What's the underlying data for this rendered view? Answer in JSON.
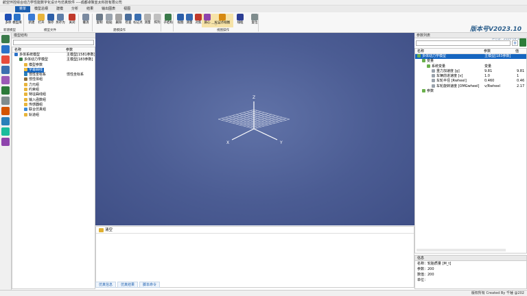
{
  "window_title": "航空环控综合动力学性能数字化设计与仿真软件 ----成都卓致亚太科技有限公司",
  "menu": [
    "菜单",
    "模型总纲",
    "建模",
    "分析",
    "结果",
    "输出图表",
    "视图"
  ],
  "ribbon": {
    "buttons": [
      {
        "label": "多体",
        "color": "#1f4fb5"
      },
      {
        "label": "模型库",
        "color": "#2a72c9"
      },
      {
        "label": "新建",
        "color": "#3a7bd5"
      },
      {
        "label": "打开",
        "color": "#e8b43a"
      },
      {
        "label": "保存",
        "color": "#2d5fa8"
      },
      {
        "label": "另存为",
        "color": "#5f7ea8"
      },
      {
        "label": "关闭",
        "color": "#c0392b"
      },
      {
        "label": "撤消",
        "color": "#7a8aa0"
      },
      {
        "label": "复制",
        "color": "#6c7a89"
      },
      {
        "label": "粘贴",
        "color": "#9aa3ad"
      },
      {
        "label": "删除",
        "color": "#a3a3a3"
      },
      {
        "label": "检查",
        "color": "#4a6d9a"
      },
      {
        "label": "标记点",
        "color": "#3b6fb0"
      },
      {
        "label": "测量",
        "color": "#b0b0b0"
      },
      {
        "label": "阵列",
        "color": "#c0c0c0"
      },
      {
        "label": "子结构",
        "color": "#3a7a4a"
      },
      {
        "label": "视图",
        "color": "#2b5ea8"
      },
      {
        "label": "测量",
        "color": "#3469b0"
      },
      {
        "label": "对焦",
        "color": "#c0392b"
      },
      {
        "label": "质心",
        "color": "#8e44ad"
      },
      {
        "label": "标记点视图",
        "color": "#d68910"
      },
      {
        "label": "线框",
        "color": "#2c3e94"
      },
      {
        "label": "复位",
        "color": "#7f8c8d"
      }
    ],
    "groups": [
      "新建模型",
      "模型文件",
      "建模操作",
      "视图操作"
    ],
    "view_slider": "一○—"
  },
  "version": {
    "title": "版本号V2023.10",
    "license": "使用期：2.11.19",
    "date": "许可证：2024-08-21"
  },
  "left_panel": {
    "title": "模型结构",
    "col_name": "名称",
    "col_param": "参数",
    "rows": [
      {
        "name": "多体系统模型",
        "param": "主模型[1581参数]",
        "indent": 0
      },
      {
        "name": "多体动力学模型",
        "param": "主模型[183参数]",
        "indent": 1
      },
      {
        "name": "模型参数",
        "param": "",
        "indent": 2
      },
      {
        "name": "字幕曲线",
        "param": "",
        "indent": 2,
        "selected": true
      },
      {
        "name": "惯性坐标系",
        "param": "惯性坐标系",
        "indent": 2
      },
      {
        "name": "惯性体组",
        "param": "",
        "indent": 2
      },
      {
        "name": "力元组",
        "param": "",
        "indent": 2
      },
      {
        "name": "约束组",
        "param": "",
        "indent": 2
      },
      {
        "name": "特征曲线组",
        "param": "",
        "indent": 2
      },
      {
        "name": "输入函数组",
        "param": "",
        "indent": 2
      },
      {
        "name": "传感器组",
        "param": "",
        "indent": 2
      },
      {
        "name": "联合仿真组",
        "param": "",
        "indent": 2
      },
      {
        "name": "轨道组",
        "param": "",
        "indent": 2
      }
    ]
  },
  "viewport": {
    "axis_z": "Z",
    "axis_x": "X",
    "axis_y": "Y"
  },
  "bottom": {
    "clear_label": "清空",
    "tabs": [
      "仿真信息",
      "仿真结果",
      "脚本命令"
    ]
  },
  "right_panel": {
    "title": "参数列表",
    "col_name": "名称",
    "col_param": "参数",
    "col_value": "值",
    "rows": [
      {
        "name": "多体动力学模型",
        "param": "主模型[183参数]",
        "value": "",
        "indent": 0,
        "selected": true
      },
      {
        "name": "变量",
        "param": "",
        "value": "",
        "indent": 1
      },
      {
        "name": "系统变量",
        "param": "变量",
        "value": "",
        "indent": 2
      },
      {
        "name": "重力加速度 [g]",
        "param": "9.81",
        "value": "9.81",
        "indent": 3
      },
      {
        "name": "车辆前进速度 [v]",
        "param": "1.0",
        "value": "1",
        "indent": 3
      },
      {
        "name": "车轮半径 [Rwheel]",
        "param": "0.460",
        "value": "0.46",
        "indent": 3
      },
      {
        "name": "车轮旋转速度 [OMGwheel]",
        "param": "v/Rwheel",
        "value": "2.17",
        "indent": 3
      },
      {
        "name": "参数",
        "param": "",
        "value": "",
        "indent": 1
      }
    ]
  },
  "detail": {
    "title": "信息",
    "name_line": "名称：轮胎质量 [M_t]",
    "param_line": "参数：200",
    "value_line": "数值：200",
    "unit_line": "单位："
  },
  "status": "版权所有 Created By 千锤 @202",
  "left_toolbar_colors": [
    "#3a7a4a",
    "#2a72c9",
    "#e74c3c",
    "#3b6fb0",
    "#9b59b6",
    "#2c7a3a",
    "#7f8c8d",
    "#d35400",
    "#2980b9",
    "#1abc9c",
    "#8e44ad"
  ]
}
